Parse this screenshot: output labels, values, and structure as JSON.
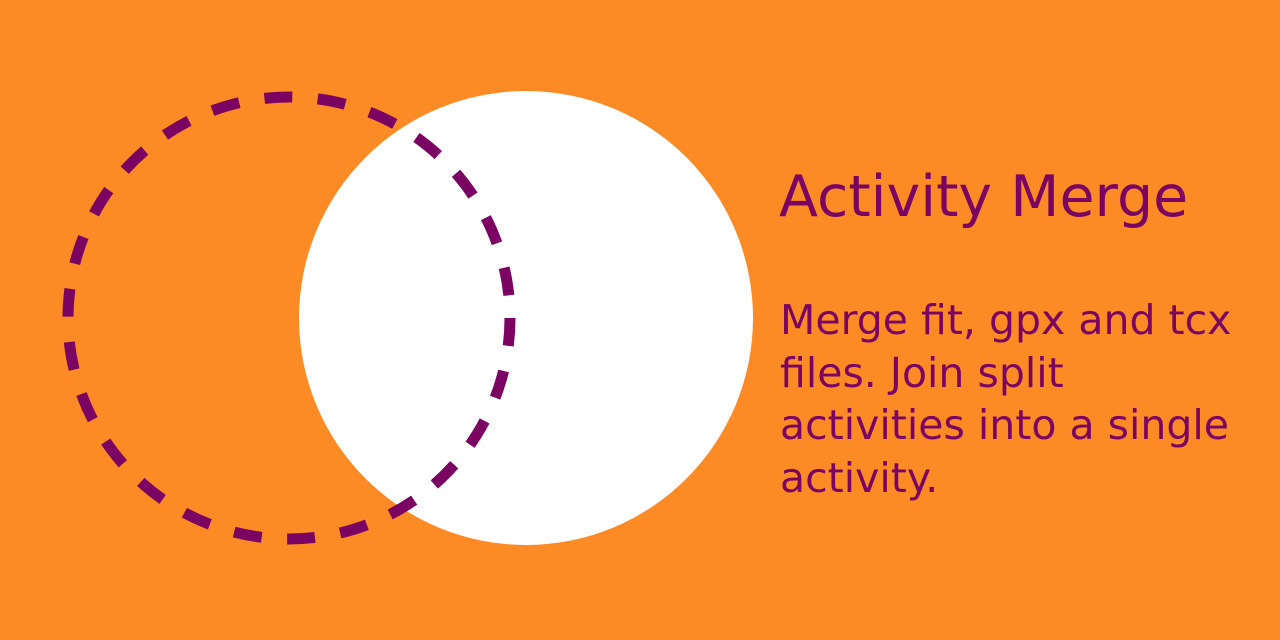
{
  "colors": {
    "background": "#fc8b26",
    "accent": "#7b0462",
    "circle_fill": "#ffffff"
  },
  "banner": {
    "title": "Activity Merge",
    "description": "Merge fit, gpx and tcx files. Join split activities into a single activity."
  },
  "logo": {
    "outline_circle_icon": "dashed-circle-icon",
    "filled_circle_icon": "solid-circle-icon"
  }
}
